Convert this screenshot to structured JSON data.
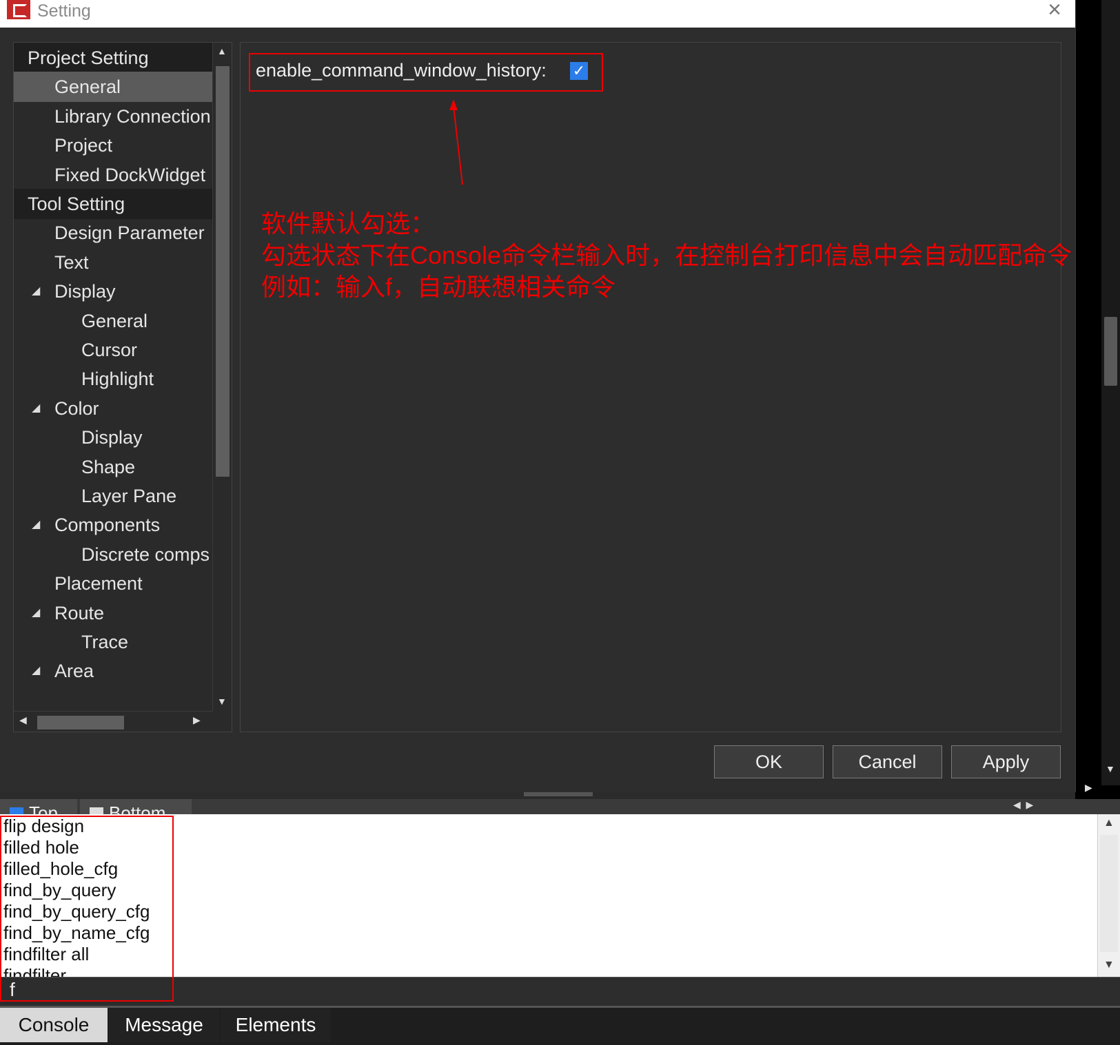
{
  "window": {
    "title": "Setting"
  },
  "tree": {
    "items": [
      {
        "label": "Project Setting",
        "level": 0,
        "section": true
      },
      {
        "label": "General",
        "level": 1,
        "selected": true
      },
      {
        "label": "Library Connection",
        "level": 1
      },
      {
        "label": "Project",
        "level": 1
      },
      {
        "label": "Fixed DockWidget",
        "level": 1
      },
      {
        "label": "Tool Setting",
        "level": 0,
        "section": true
      },
      {
        "label": "Design Parameter",
        "level": 1
      },
      {
        "label": "Text",
        "level": 1
      },
      {
        "label": "Display",
        "level": 1,
        "expanded": true
      },
      {
        "label": "General",
        "level": 2
      },
      {
        "label": "Cursor",
        "level": 2
      },
      {
        "label": "Highlight",
        "level": 2
      },
      {
        "label": "Color",
        "level": 1,
        "expanded": true
      },
      {
        "label": "Display",
        "level": 2
      },
      {
        "label": "Shape",
        "level": 2
      },
      {
        "label": "Layer Pane",
        "level": 2
      },
      {
        "label": "Components",
        "level": 1,
        "expanded": true
      },
      {
        "label": "Discrete comps",
        "level": 2
      },
      {
        "label": "Placement",
        "level": 1
      },
      {
        "label": "Route",
        "level": 1,
        "expanded": true
      },
      {
        "label": "Trace",
        "level": 2
      },
      {
        "label": "Area",
        "level": 1,
        "expanded": true
      }
    ]
  },
  "setting": {
    "label": "enable_command_window_history:",
    "checked": true
  },
  "annotation": {
    "lines": [
      "软件默认勾选：",
      "勾选状态下在Console命令栏输入时，在控制台打印信息中会自动匹配命令",
      "例如：输入f，自动联想相关命令"
    ],
    "color": "#e00000"
  },
  "buttons": {
    "ok": "OK",
    "cancel": "Cancel",
    "apply": "Apply"
  },
  "layer_tabs": {
    "top": "Top",
    "bottom": "Bottom"
  },
  "console": {
    "suggestions": [
      "flip design",
      "filled hole",
      "filled_hole_cfg",
      "find_by_query",
      "find_by_query_cfg",
      "find_by_name_cfg",
      "findfilter all",
      "findfilter"
    ],
    "input": "f"
  },
  "bottom_tabs": {
    "console": "Console",
    "message": "Message",
    "elements": "Elements"
  }
}
